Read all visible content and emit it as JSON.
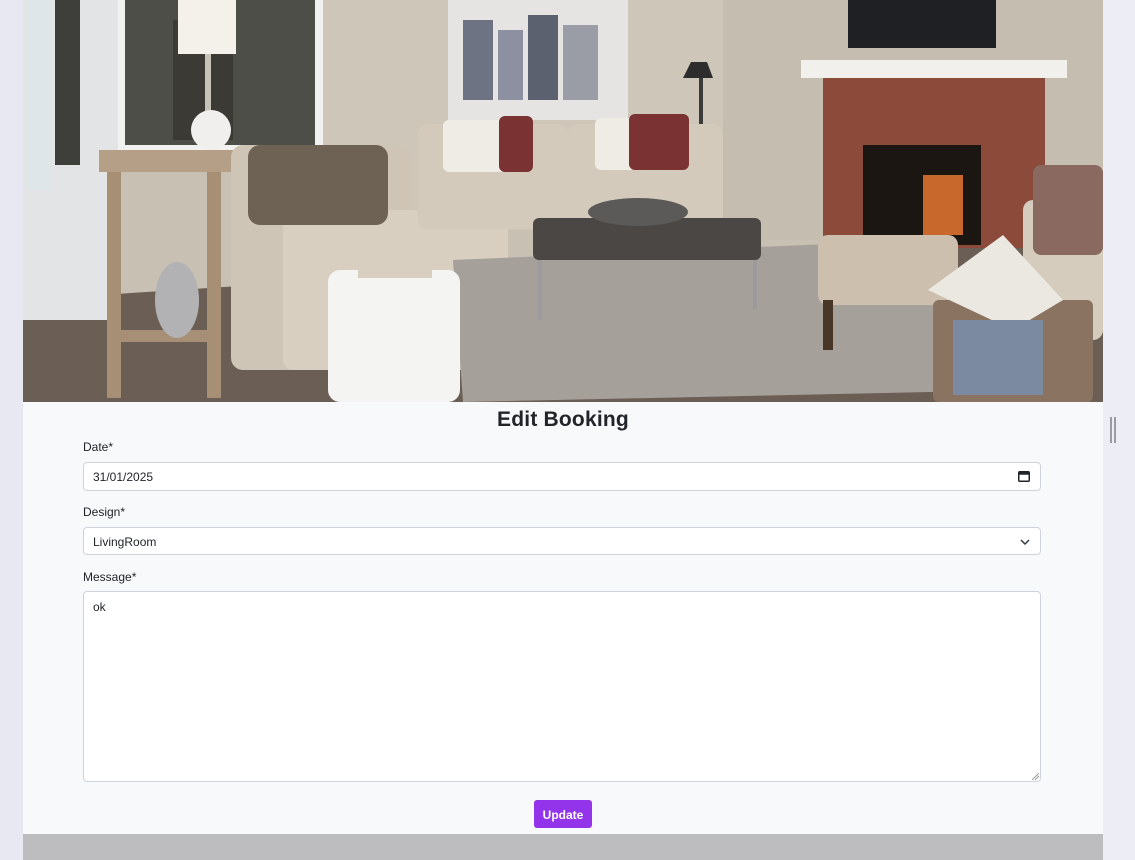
{
  "form": {
    "title": "Edit Booking",
    "date": {
      "label": "Date*",
      "value": "31/01/2025"
    },
    "design": {
      "label": "Design*",
      "value": "LivingRoom"
    },
    "message": {
      "label": "Message*",
      "value": "ok"
    },
    "submit_label": "Update"
  },
  "colors": {
    "accent": "#9333ea",
    "background": "#f8f9fa",
    "page_background": "#e8e8f2",
    "footer": "#bdbdc0"
  },
  "icons": {
    "date_picker": "calendar-icon",
    "select": "chevron-down-icon",
    "textarea": "resize-handle-icon"
  },
  "hero_image": {
    "subject": "living room interior"
  }
}
